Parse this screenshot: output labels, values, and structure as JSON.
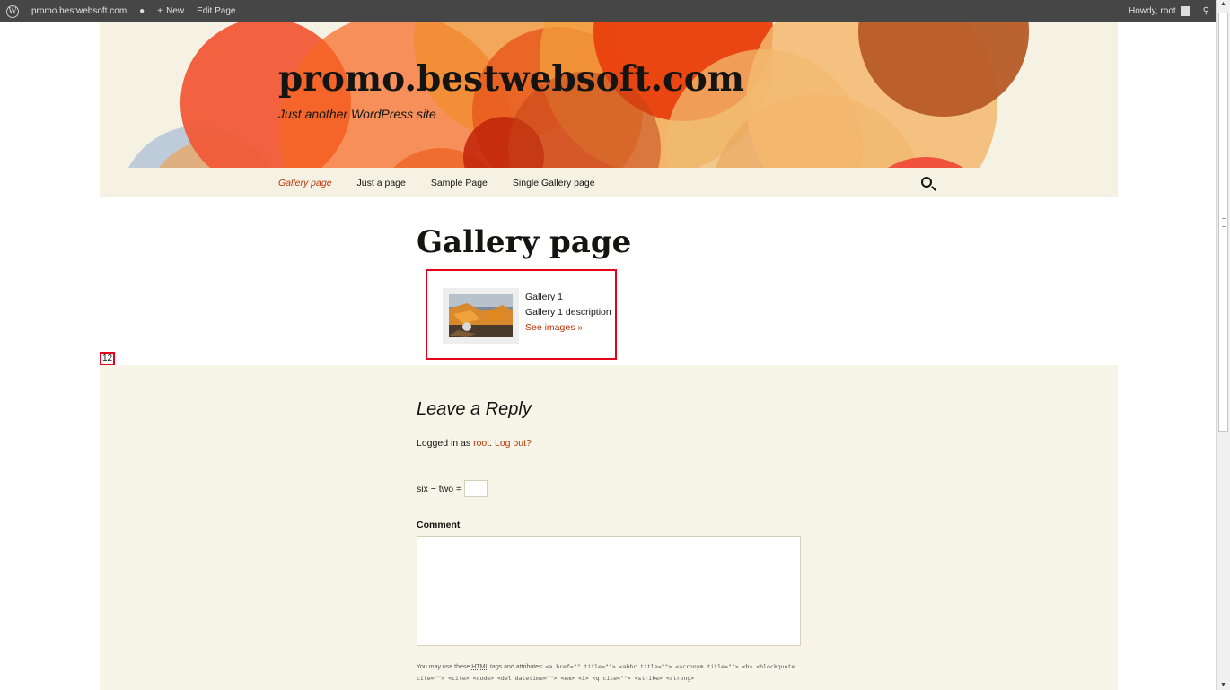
{
  "adminbar": {
    "site_name": "promo.bestwebsoft.com",
    "new_label": "New",
    "edit_label": "Edit Page",
    "howdy": "Howdy, root"
  },
  "header": {
    "site_title": "promo.bestwebsoft.com",
    "site_description": "Just another WordPress site"
  },
  "nav": {
    "items": [
      {
        "label": "Gallery page",
        "current": true
      },
      {
        "label": "Just a page"
      },
      {
        "label": "Sample Page"
      },
      {
        "label": "Single Gallery page"
      }
    ]
  },
  "content": {
    "title": "Gallery page",
    "gallery": {
      "name": "Gallery 1",
      "description": "Gallery 1 description",
      "link": "See images »"
    },
    "counter": "12"
  },
  "comments": {
    "reply_title": "Leave a Reply",
    "logged_in_prefix": "Logged in as ",
    "user": "root",
    "separator": ". ",
    "logout": "Log out?",
    "captcha_question": "six − two =",
    "comment_label": "Comment",
    "allowed_prefix": "You may use these ",
    "allowed_html": "HTML",
    "allowed_suffix": " tags and attributes: ",
    "allowed_code": "<a href=\"\" title=\"\"> <abbr title=\"\"> <acronym title=\"\"> <b> <blockquote cite=\"\"> <cite> <code> <del datetime=\"\"> <em> <i> <q cite=\"\"> <strike> <strong>"
  },
  "colors": {
    "accent": "#bc360a",
    "highlight": "#e5001c",
    "header_bg": "#f5f2e4"
  }
}
